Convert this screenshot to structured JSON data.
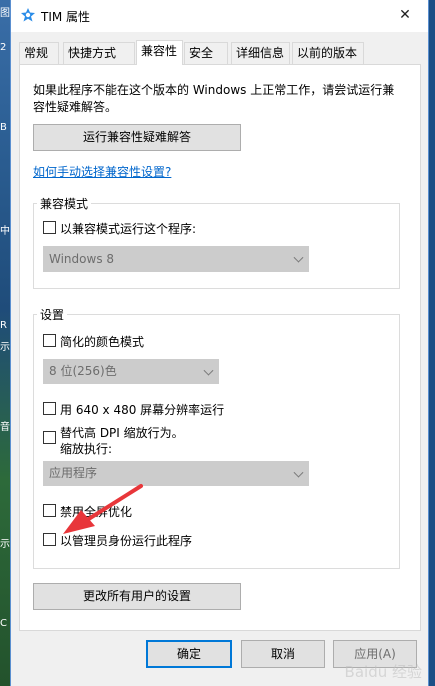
{
  "window": {
    "title": "TIM 属性",
    "close_glyph": "✕"
  },
  "tabs": [
    {
      "label": "常规",
      "active": false
    },
    {
      "label": "快捷方式",
      "active": false
    },
    {
      "label": "兼容性",
      "active": true
    },
    {
      "label": "安全",
      "active": false
    },
    {
      "label": "详细信息",
      "active": false
    },
    {
      "label": "以前的版本",
      "active": false
    }
  ],
  "compat": {
    "intro_line1": "如果此程序不能在这个版本的 Windows 上正常工作，请尝试运行兼",
    "intro_line2": "容性疑难解答。",
    "troubleshoot_button": "运行兼容性疑难解答",
    "manual_link": "如何手动选择兼容性设置?",
    "mode_group": {
      "label": "兼容模式",
      "checkbox_label": "以兼容模式运行这个程序:",
      "os_select_value": "Windows 8"
    },
    "settings_group": {
      "label": "设置",
      "reduced_color_label": "简化的颜色模式",
      "color_select_value": "8 位(256)色",
      "resolution_label": "用 640 x 480 屏幕分辨率运行",
      "dpi_label_line1": "替代高 DPI 缩放行为。",
      "dpi_label_line2": "缩放执行:",
      "dpi_select_value": "应用程序",
      "fullscreen_label": "禁用全屏优化",
      "admin_label": "以管理员身份运行此程序"
    },
    "all_users_button": "更改所有用户的设置"
  },
  "footer": {
    "ok_label": "确定",
    "cancel_label": "取消",
    "apply_label": "应用(A)"
  },
  "watermark": "Baidu 经验",
  "desktop_edge_chars": [
    "图",
    "2",
    "B",
    "中",
    "R",
    "示",
    "音",
    "示",
    "C"
  ],
  "colors": {
    "accent": "#0078d7",
    "link": "#0066cc",
    "arrow": "#e8363a"
  }
}
